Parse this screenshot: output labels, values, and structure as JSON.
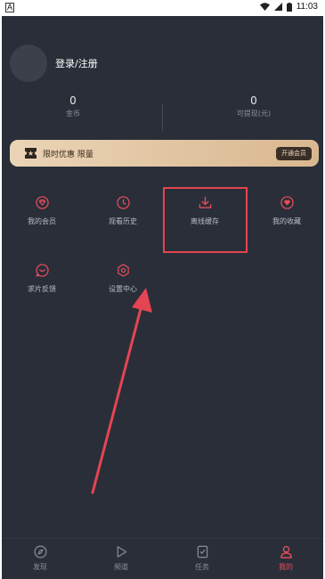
{
  "status_bar": {
    "indicator": "A",
    "time": "11:03"
  },
  "profile": {
    "login_label": "登录/注册"
  },
  "stats": [
    {
      "value": "0",
      "label": "金币"
    },
    {
      "value": "0",
      "label": "可提现(元)"
    }
  ],
  "vip_banner": {
    "promo_text": "限时优惠 限量",
    "button_label": "开通会员"
  },
  "menu_grid": [
    {
      "label": "我的会员",
      "icon": "diamond-icon"
    },
    {
      "label": "观看历史",
      "icon": "clock-icon"
    },
    {
      "label": "离线缓存",
      "icon": "download-icon"
    },
    {
      "label": "我的收藏",
      "icon": "heart-icon"
    },
    {
      "label": "求片反馈",
      "icon": "feedback-icon"
    },
    {
      "label": "设置中心",
      "icon": "gear-icon"
    }
  ],
  "tab_bar": [
    {
      "label": "发现",
      "icon": "compass-icon",
      "active": false
    },
    {
      "label": "频道",
      "icon": "play-icon",
      "active": false
    },
    {
      "label": "任务",
      "icon": "task-icon",
      "active": false
    },
    {
      "label": "我的",
      "icon": "user-icon",
      "active": true
    }
  ],
  "colors": {
    "background": "#2a2e39",
    "accent": "#ec4d5c",
    "vip_gold": "#e3c7a2"
  }
}
